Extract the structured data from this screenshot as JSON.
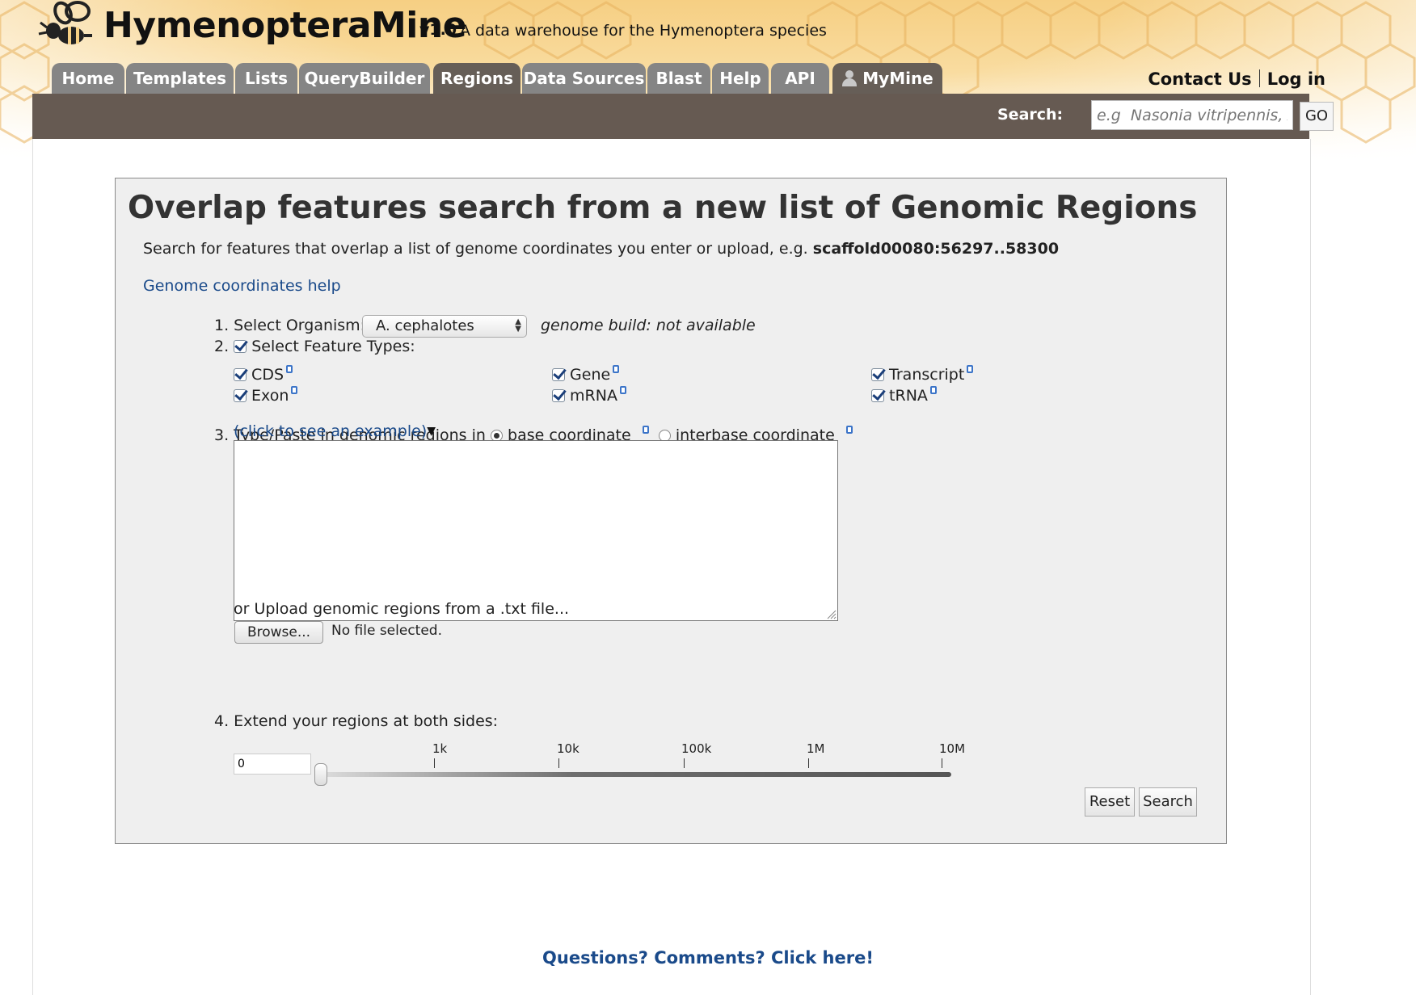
{
  "header": {
    "title": "HymenopteraMine",
    "version": "v1.0",
    "tagline": "A data warehouse for the Hymenoptera species",
    "logo_icon": "bee-icon"
  },
  "nav": {
    "tabs": [
      {
        "label": "Home",
        "active": false
      },
      {
        "label": "Templates",
        "active": false
      },
      {
        "label": "Lists",
        "active": false
      },
      {
        "label": "QueryBuilder",
        "active": false
      },
      {
        "label": "Regions",
        "active": true
      },
      {
        "label": "Data Sources",
        "active": false
      },
      {
        "label": "Blast",
        "active": false
      },
      {
        "label": "Help",
        "active": false
      },
      {
        "label": "API",
        "active": false
      },
      {
        "label": "MyMine",
        "active": false,
        "icon": "user-icon"
      }
    ],
    "contact_label": "Contact Us",
    "login_label": "Log in"
  },
  "search": {
    "label": "Search:",
    "placeholder": "e.g  Nasonia vitripennis, A",
    "go_label": "GO"
  },
  "panel": {
    "title": "Overlap features search from a new list of Genomic Regions",
    "description": "Search for features that overlap a list of genome coordinates you enter or upload, e.g.",
    "example_coord": "scaffold00080:56297..58300",
    "help_link": "Genome coordinates help",
    "step1_label": "1. Select Organism:",
    "organism_selected": "A. cephalotes",
    "genome_build": "genome build: not available",
    "step2_label": "2.",
    "step2_text": "Select Feature Types:",
    "feature_types": [
      {
        "label": "CDS",
        "checked": true
      },
      {
        "label": "Gene",
        "checked": true
      },
      {
        "label": "Transcript",
        "checked": true
      },
      {
        "label": "Exon",
        "checked": true
      },
      {
        "label": "mRNA",
        "checked": true
      },
      {
        "label": "tRNA",
        "checked": true
      }
    ],
    "step3_label": "3. Type/Paste in genomic regions in",
    "coord_base": "base coordinate",
    "coord_interbase": "interbase coordinate",
    "coord_selected": "base coordinate",
    "example_link": "(click to see an example)",
    "example_arrow": "▼",
    "regions_value": "",
    "upload_label": "or Upload genomic regions from a .txt file...",
    "browse_label": "Browse...",
    "no_file": "No file selected.",
    "step4_label": "4. Extend your regions at both sides:",
    "extend_value": "0",
    "slider_ticks": [
      "1k",
      "10k",
      "100k",
      "1M",
      "10M"
    ],
    "slider_value": 0,
    "reset_label": "Reset",
    "search_label": "Search"
  },
  "footer": {
    "link": "Questions? Comments? Click here!"
  },
  "colors": {
    "tab_inactive": "#858585",
    "tab_active": "#665e57",
    "search_bar": "#665a52",
    "link": "#1a4a8a",
    "panel_bg": "#efefef"
  }
}
